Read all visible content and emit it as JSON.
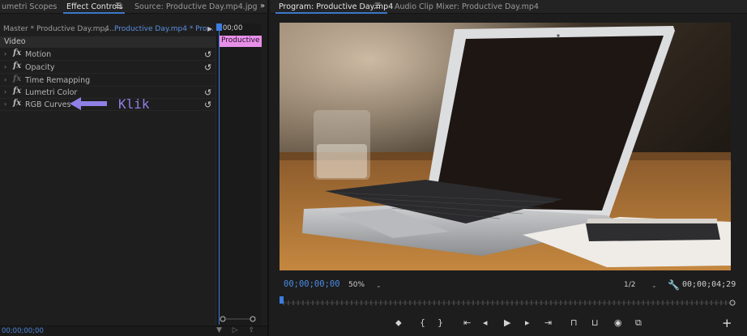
{
  "left_tabs": [
    {
      "label": "umetri Scopes"
    },
    {
      "label": "Effect Controls",
      "active": true
    },
    {
      "label": "Source: Productive Day.mp4.jpg"
    }
  ],
  "left_overflow": "»",
  "effect_controls": {
    "master_label": "Master * Productive Day.mp4...",
    "clip_label": "Productive Day.mp4 * Pro...",
    "section": "Video",
    "effects": [
      {
        "name": "Motion",
        "enabled": true
      },
      {
        "name": "Opacity",
        "enabled": true
      },
      {
        "name": "Time Remapping",
        "enabled": false
      },
      {
        "name": "Lumetri Color",
        "enabled": true
      },
      {
        "name": "RGB Curves",
        "enabled": true
      }
    ],
    "timeline_timecode": ":00;00",
    "timeline_clip": "Productive D",
    "bottom_timecode": "00;00;00;00"
  },
  "annotation": {
    "text": "Klik",
    "color": "#8f80e6"
  },
  "right_tabs": [
    {
      "label": "Program: Productive Day.mp4",
      "active": true
    },
    {
      "label": "Audio Clip Mixer: Productive Day.mp4"
    }
  ],
  "program": {
    "timecode_current": "00;00;00;00",
    "zoom": "50%",
    "resolution": "1/2",
    "timecode_duration": "00;00;04;29"
  },
  "icons": {
    "menu": "☰",
    "reset": "↺",
    "wrench": "🔧",
    "transport": [
      "marker-icon",
      "mark-in-icon",
      "mark-out-icon",
      "go-to-in-icon",
      "step-back-icon",
      "play-icon",
      "step-forward-icon",
      "go-to-out-icon",
      "lift-icon",
      "extract-icon",
      "export-frame-icon",
      "compare-icon",
      "add-button-icon"
    ]
  },
  "colors": {
    "accent": "#3c7de0",
    "clip": "#e790e8",
    "timecode": "#4a8ce6"
  }
}
